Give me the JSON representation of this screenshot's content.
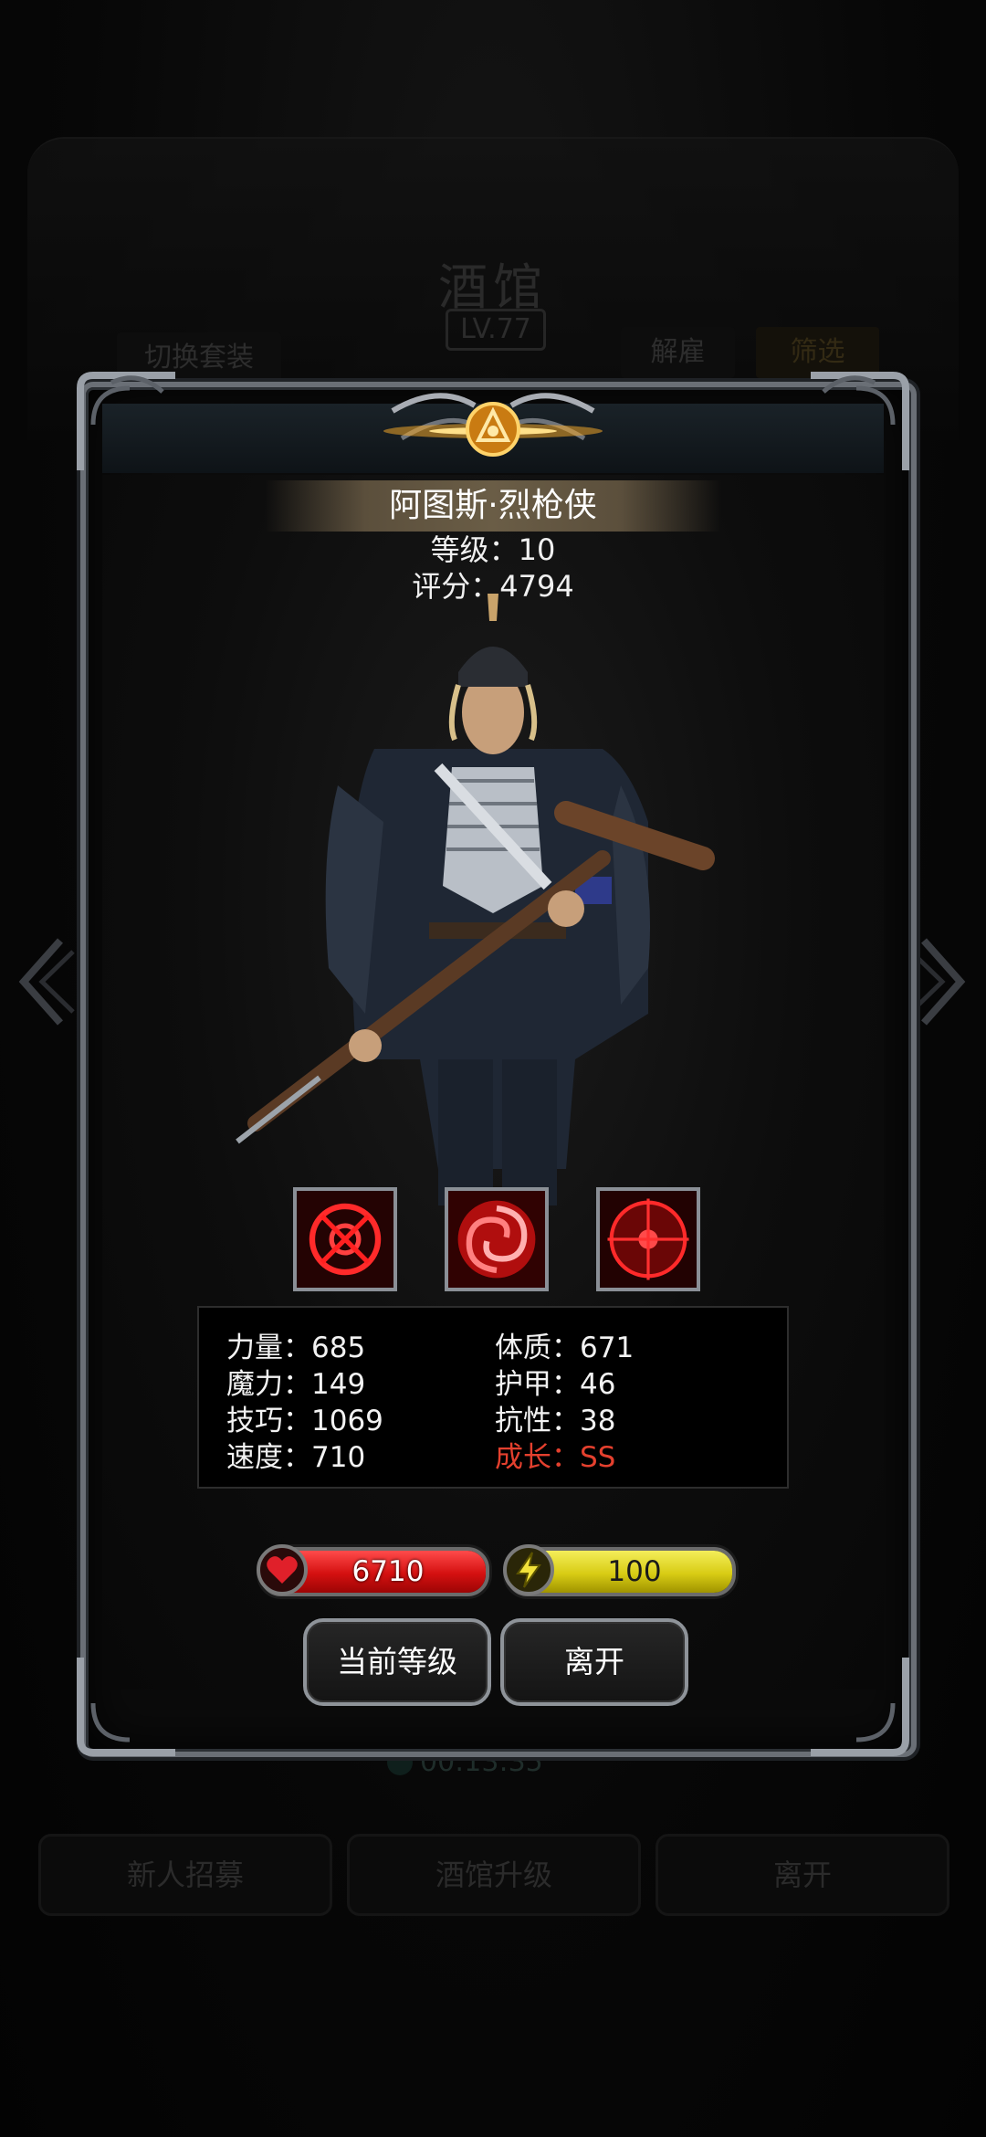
{
  "background": {
    "title": "酒馆",
    "level": "LV.77",
    "switch_outfit": "切换套装",
    "dismiss": "解雇",
    "filter": "筛选",
    "timer": "00:13:35",
    "bottom_buttons": [
      "新人招募",
      "酒馆升级",
      "离开"
    ]
  },
  "hero": {
    "name": "阿图斯·烈枪侠",
    "level_text": "等级：10",
    "score_text": "评分：4794"
  },
  "skills": [
    "target-skill-icon",
    "vortex-skill-icon",
    "crosshair-skill-icon"
  ],
  "stats": {
    "strength": {
      "label": "力量：",
      "value": "685"
    },
    "constitution": {
      "label": "体质：",
      "value": "671"
    },
    "magic": {
      "label": "魔力：",
      "value": "149"
    },
    "armor": {
      "label": "护甲：",
      "value": "46"
    },
    "skill": {
      "label": "技巧：",
      "value": "1069"
    },
    "resistance": {
      "label": "抗性：",
      "value": "38"
    },
    "speed": {
      "label": "速度：",
      "value": "710"
    },
    "growth": {
      "label": "成长：",
      "value": "SS"
    }
  },
  "bars": {
    "hp": {
      "value": "6710",
      "fill_fraction": 1.0
    },
    "energy": {
      "value": "100",
      "fill_fraction": 1.0
    }
  },
  "buttons": {
    "current_level": "当前等级",
    "leave": "离开"
  },
  "colors": {
    "growth": "#e4402e",
    "hp": "#d41010",
    "energy": "#d8cc14",
    "frame": "#8e9399"
  }
}
